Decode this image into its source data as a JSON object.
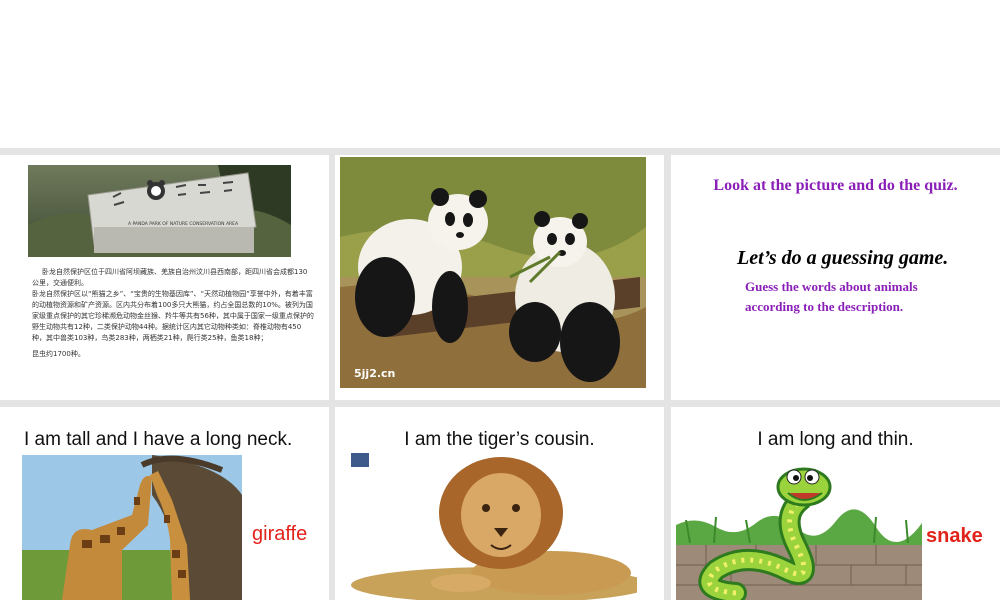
{
  "slide1": {
    "sign_latin": "A PANDA PARK OF NATURE CONSERVATION AREA",
    "paragraphs": [
      "卧龙自然保护区位于四川省阿坝藏族、羌族自治州汶川县西南部，距四川省会成都130公里，交通便利。",
      "卧龙自然保护区以“熊猫之乡”、“宝贵的生物基因库”、“天然动植物园”享誉中外，有着丰富的动植物资源和矿产资源。区内共分布着100多只大熊猫，约占全国总数的10%。被列为国家级重点保护的其它珍稀濒危动物金丝猴、羚牛等共有56种，其中属于国家一级重点保护的野生动物共有12种，二类保护动物44种。据统计区内其它动物种类如：脊椎动物有450种，其中兽类103种，鸟类283种，两栖类21种，爬行类25种，鱼类18种；",
      "昆虫约1700种。"
    ]
  },
  "slide2": {
    "watermark": "5jj2.cn"
  },
  "slide3": {
    "line1": "Look at the picture and do the quiz.",
    "line2": "Let’s do a guessing game.",
    "line3": "Guess the words about animals according to the description."
  },
  "slide4": {
    "caption": "I am tall and I have a long neck.",
    "answer": "giraffe"
  },
  "slide5": {
    "caption": "I am the tiger’s cousin."
  },
  "slide6": {
    "caption": "I am long and thin.",
    "answer": "snake"
  },
  "colors": {
    "purple": "#8a1fb8",
    "red": "#e2231a",
    "separator": "#e4e4e4"
  }
}
